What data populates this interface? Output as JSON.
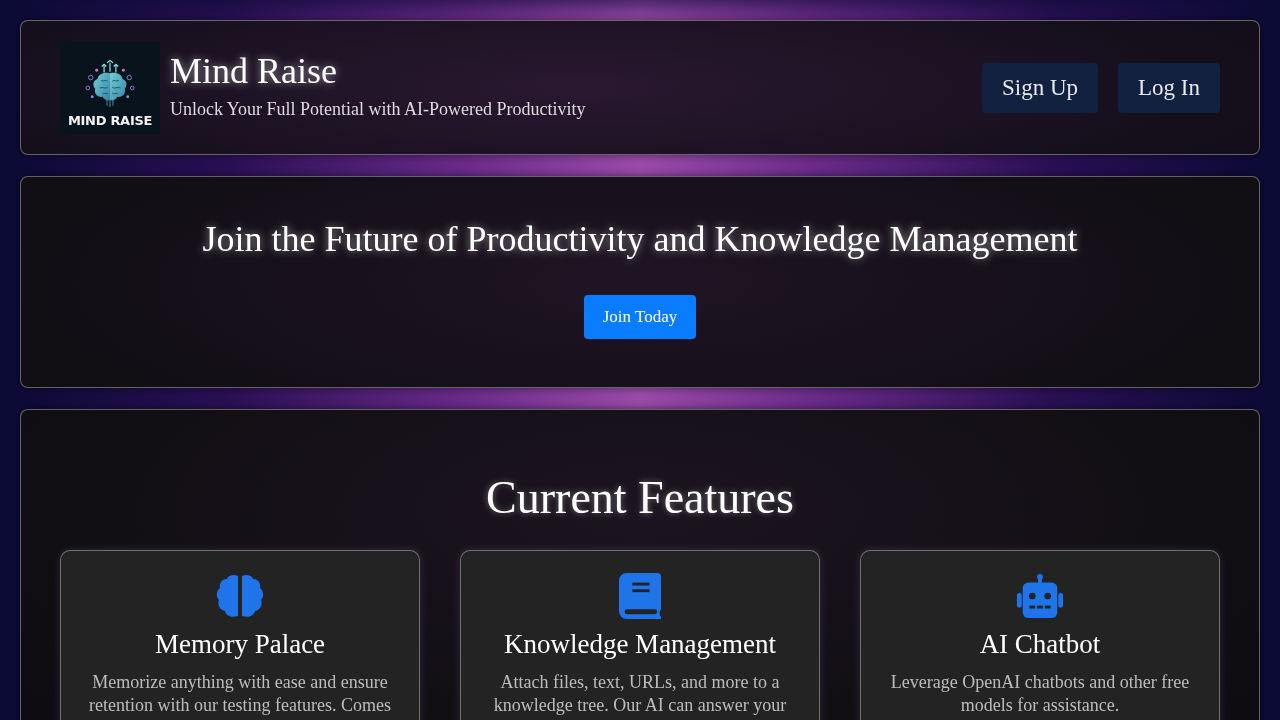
{
  "header": {
    "logo": {
      "text": "MIND RAISE"
    },
    "title": "Mind Raise",
    "subtitle": "Unlock Your Full Potential with AI-Powered Productivity",
    "buttons": [
      {
        "label": "Sign Up"
      },
      {
        "label": "Log In"
      }
    ]
  },
  "hero": {
    "heading": "Join the Future of Productivity and Knowledge Management",
    "button": "Join Today"
  },
  "features": {
    "title": "Current Features",
    "items": [
      {
        "kind": "brain",
        "title": "Memory Palace",
        "description": "Memorize anything with ease and ensure retention with our testing features. Comes"
      },
      {
        "kind": "book",
        "title": "Knowledge Management",
        "description": "Attach files, text, URLs, and more to a knowledge tree. Our AI can answer your"
      },
      {
        "kind": "robot",
        "title": "AI Chatbot",
        "description": "Leverage OpenAI chatbots and other free models for assistance."
      }
    ]
  }
}
